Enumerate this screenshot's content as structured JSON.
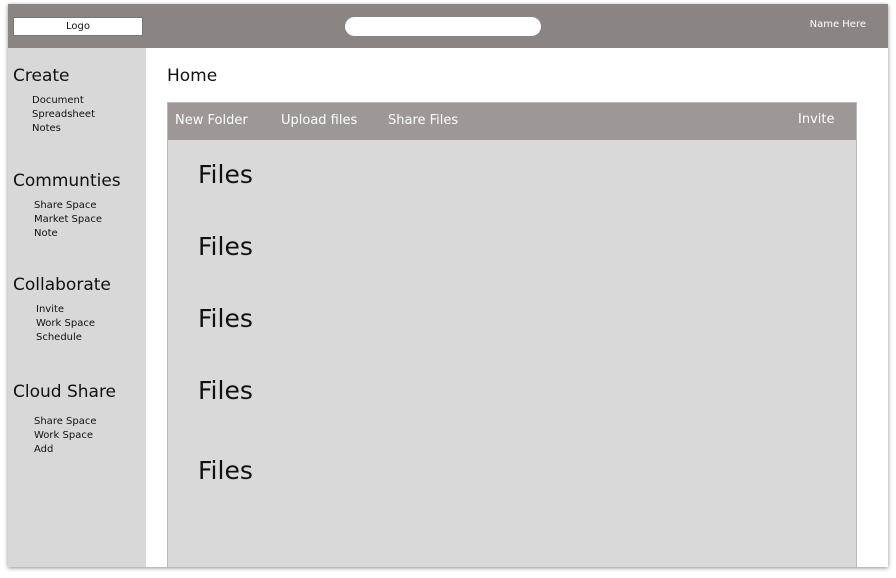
{
  "header": {
    "logo_label": "Logo",
    "search_value": "",
    "user_name": "Name Here"
  },
  "sidebar": {
    "sections": [
      {
        "heading": "Create",
        "items": [
          "Document",
          "Spreadsheet",
          "Notes"
        ]
      },
      {
        "heading": "Communties",
        "items": [
          "Share Space",
          "Market Space",
          "Note"
        ]
      },
      {
        "heading": "Collaborate",
        "items": [
          "Invite",
          "Work Space",
          "Schedule"
        ]
      },
      {
        "heading": "Cloud Share",
        "items": [
          "Share Space",
          "Work Space",
          "Add"
        ]
      }
    ]
  },
  "main": {
    "title": "Home",
    "toolbar": {
      "new_folder": "New Folder",
      "upload_files": "Upload files",
      "share_files": "Share Files",
      "invite": "Invite"
    },
    "files": [
      "Files",
      "Files",
      "Files",
      "Files",
      "Files"
    ]
  },
  "colors": {
    "header_bg": "#8a8483",
    "sidebar_bg": "#d8d8d8",
    "toolbar_bg": "#9d9796",
    "panel_bg": "#d9d9d9"
  }
}
